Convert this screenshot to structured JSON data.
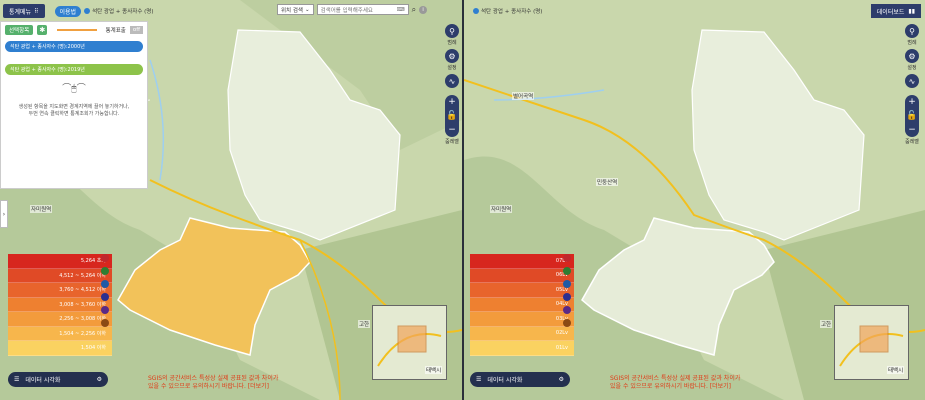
{
  "left": {
    "menu_label": "통계메뉴",
    "tab_label": "이용법",
    "crumb": "석탄 광업 + 종사자수 (명)",
    "search_select": "위치 검색",
    "search_placeholder": "검색어를 입력해주세요",
    "sel_button": "선택항목",
    "toggle_label": "통계표출",
    "toggle_value": "off",
    "pill1": "석탄 광업 + 종사자수 (명):2000년",
    "pill2": "석탄 광업 + 종사자수 (명):2019년",
    "hint": [
      "생성된 항목을 지도화면 경계지역에 끌어 놓기하거나,",
      "두번 연속 클릭하면 통계조회가 가능합니다."
    ],
    "legend": [
      "5,264 초과",
      "4,512 ~ 5,264 이하",
      "3,760 ~ 4,512 이하",
      "3,008 ~ 3,760 이하",
      "2,256 ~ 3,008 이하",
      "1,504 ~ 2,256 이하",
      "1,504 이하"
    ],
    "viz_label": "데이터 시각화",
    "warning": [
      "SGIS의 공간서비스 특성상 실제 공표된 값과 차이가",
      "있을 수 있으므로 유의하시기 바랍니다. [더보기]"
    ],
    "control_labels": [
      "범례",
      "설정",
      "줌레벨"
    ],
    "places": [
      "자미원역",
      "태백시",
      "고한"
    ]
  },
  "right": {
    "crumb": "석탄 광업 + 종사자수 (명)",
    "dashboard": "데이터보드",
    "legend": [
      "07Lv",
      "06Lv",
      "05Lv",
      "04Lv",
      "03Lv",
      "02Lv",
      "01Lv"
    ],
    "viz_label": "데이터 시각화",
    "warning": [
      "SGIS의 공간서비스 특성상 실제 공표된 값과 차이가",
      "있을 수 있으므로 유의하시기 바랍니다. [더보기]"
    ],
    "places": [
      "별어곡역",
      "민둥산역",
      "자미원역",
      "고한",
      "태백시"
    ]
  },
  "colors": {
    "legend": [
      "#d7261e",
      "#e04a26",
      "#e8642c",
      "#ee8030",
      "#f39b3c",
      "#f7b64c",
      "#fad261"
    ],
    "swatches": [
      "#c0282d",
      "#2e7d32",
      "#1f5aa6",
      "#2d2f8f",
      "#5b2a86",
      "#8b4a14"
    ],
    "highlight": "#f2c25a",
    "region": "#e8eedc"
  }
}
